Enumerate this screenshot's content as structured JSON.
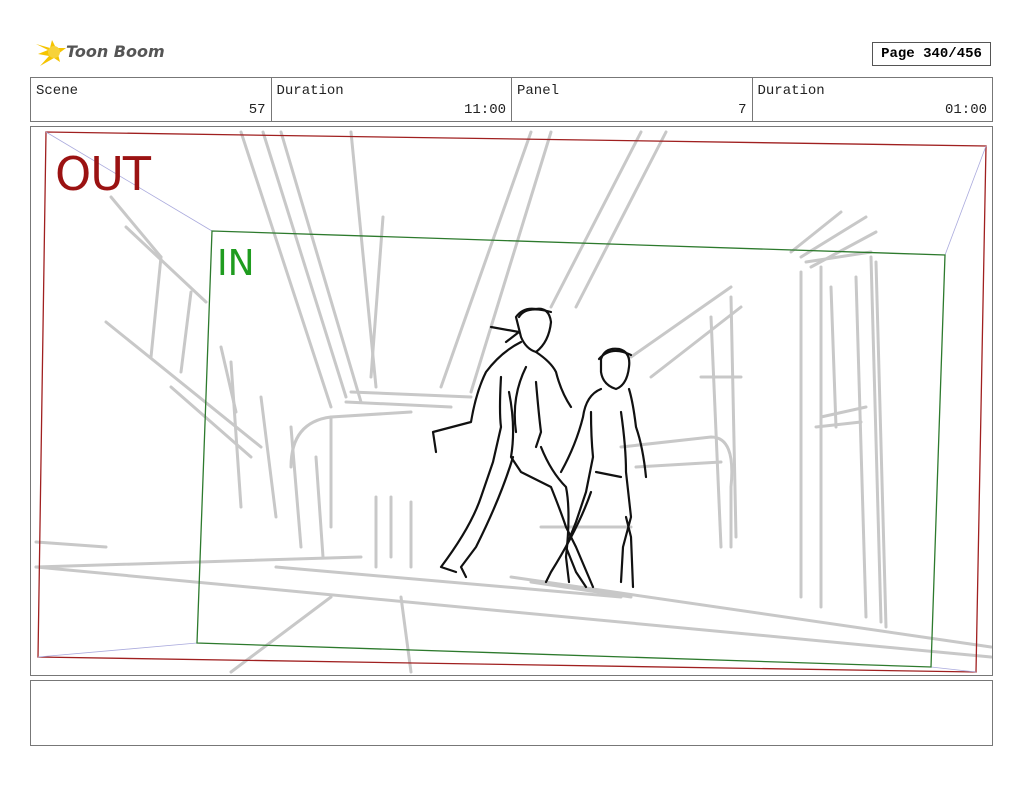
{
  "brand": {
    "name": "Toon Boom",
    "logo_icon": "toon-boom-star-icon",
    "color": "#f5c400"
  },
  "page": {
    "label": "Page 340/456"
  },
  "header": {
    "scene_label": "Scene",
    "scene_value": "57",
    "scene_duration_label": "Duration",
    "scene_duration_value": "11:00",
    "panel_label": "Panel",
    "panel_value": "7",
    "panel_duration_label": "Duration",
    "panel_duration_value": "01:00"
  },
  "panel_frame": {
    "out_label": "OUT",
    "out_color": "#9b1212",
    "in_label": "IN",
    "in_color": "#1f9c1f"
  },
  "notes": {
    "text": ""
  }
}
